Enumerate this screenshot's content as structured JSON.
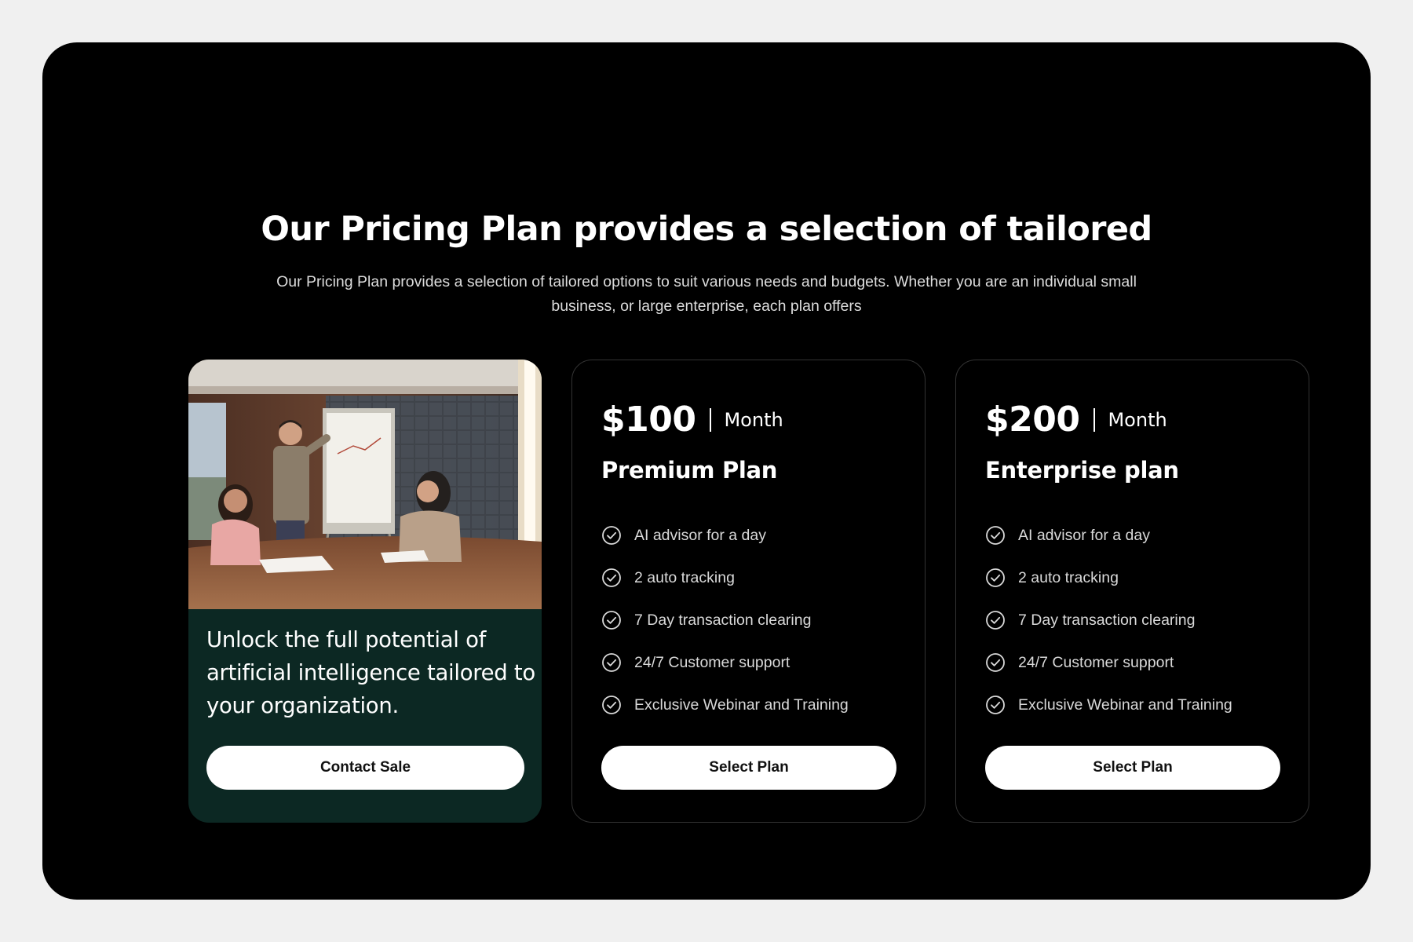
{
  "header": {
    "title": "Our Pricing Plan provides a selection of tailored",
    "subtitle": "Our Pricing Plan provides a selection of tailored options to suit various needs and budgets. Whether you are an individual small business, or large enterprise, each plan offers"
  },
  "promo": {
    "image_alt": "Team meeting with presenter at whiteboard",
    "text": "Unlock the full potential of artificial intelligence tailored to your organization.",
    "button_label": "Contact Sale"
  },
  "plans": [
    {
      "price": "$100",
      "period": "Month",
      "name": "Premium Plan",
      "features": [
        "AI advisor for a day",
        "2 auto tracking",
        "7 Day transaction clearing",
        "24/7 Customer support",
        "Exclusive Webinar and Training"
      ],
      "button_label": "Select Plan"
    },
    {
      "price": "$200",
      "period": "Month",
      "name": "Enterprise plan",
      "features": [
        "AI advisor for a day",
        "2 auto tracking",
        "7 Day transaction clearing",
        "24/7 Customer support",
        "Exclusive Webinar and Training"
      ],
      "button_label": "Select Plan"
    }
  ],
  "icons": {
    "feature_icon": "check-circle-icon"
  },
  "colors": {
    "page_background": "#f0f0f0",
    "frame_background": "#000000",
    "promo_background": "#0c2823",
    "button_background": "#ffffff"
  }
}
